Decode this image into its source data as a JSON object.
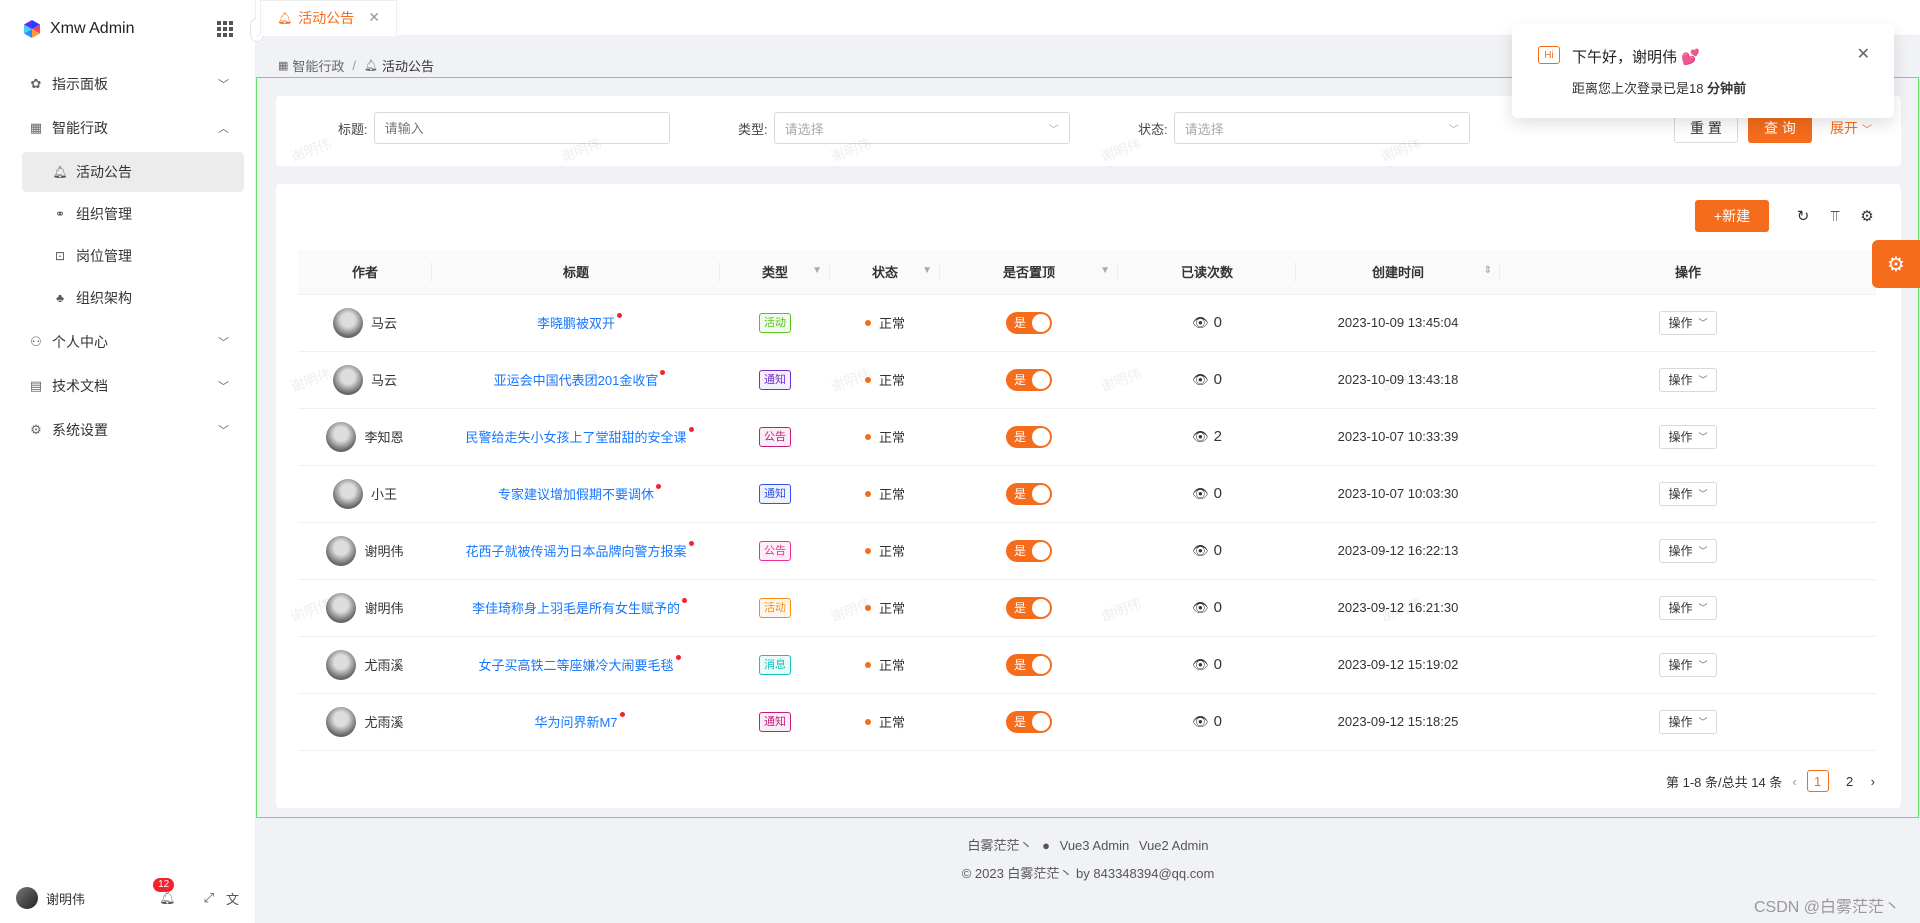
{
  "app": {
    "title": "Xmw Admin"
  },
  "sidebar": {
    "items": [
      {
        "label": "指示面板",
        "icon": "dashboard-icon",
        "expanded": false
      },
      {
        "label": "智能行政",
        "icon": "building-icon",
        "expanded": true,
        "children": [
          {
            "label": "活动公告",
            "icon": "bell-icon",
            "active": true
          },
          {
            "label": "组织管理",
            "icon": "org-icon"
          },
          {
            "label": "岗位管理",
            "icon": "position-icon"
          },
          {
            "label": "组织架构",
            "icon": "sitemap-icon"
          }
        ]
      },
      {
        "label": "个人中心",
        "icon": "user-icon",
        "expanded": false
      },
      {
        "label": "技术文档",
        "icon": "doc-icon",
        "expanded": false
      },
      {
        "label": "系统设置",
        "icon": "gear-icon",
        "expanded": false
      }
    ],
    "user": {
      "name": "谢明伟",
      "notifications": "12"
    }
  },
  "tabs": [
    {
      "label": "活动公告",
      "active": true
    }
  ],
  "breadcrumb": [
    "智能行政",
    "活动公告"
  ],
  "search": {
    "title_label": "标题:",
    "title_placeholder": "请输入",
    "type_label": "类型:",
    "type_placeholder": "请选择",
    "status_label": "状态:",
    "status_placeholder": "请选择",
    "reset": "重 置",
    "query": "查 询",
    "expand": "展开"
  },
  "toolbar": {
    "new_label": "+新建"
  },
  "table": {
    "columns": [
      "作者",
      "标题",
      "类型",
      "状态",
      "是否置顶",
      "已读次数",
      "创建时间",
      "操作"
    ],
    "rows": [
      {
        "author": "马云",
        "title": "李晓鹏被双开",
        "type": "活动",
        "type_color": "#52c41a",
        "status": "正常",
        "pinned": "是",
        "reads": "0",
        "created": "2023-10-09 13:45:04",
        "op": "操作"
      },
      {
        "author": "马云",
        "title": "亚运会中国代表团201金收官",
        "type": "通知",
        "type_color": "#722ed1",
        "status": "正常",
        "pinned": "是",
        "reads": "0",
        "created": "2023-10-09 13:43:18",
        "op": "操作"
      },
      {
        "author": "李知恩",
        "title": "民警给走失小女孩上了堂甜甜的安全课",
        "type": "公告",
        "type_color": "#c41d7f",
        "status": "正常",
        "pinned": "是",
        "reads": "2",
        "created": "2023-10-07 10:33:39",
        "op": "操作"
      },
      {
        "author": "小王",
        "title": "专家建议增加假期不要调休",
        "type": "通知",
        "type_color": "#2f54eb",
        "status": "正常",
        "pinned": "是",
        "reads": "0",
        "created": "2023-10-07 10:03:30",
        "op": "操作"
      },
      {
        "author": "谢明伟",
        "title": "花西子就被传谣为日本品牌向警方报案",
        "type": "公告",
        "type_color": "#eb2f96",
        "status": "正常",
        "pinned": "是",
        "reads": "0",
        "created": "2023-09-12 16:22:13",
        "op": "操作"
      },
      {
        "author": "谢明伟",
        "title": "李佳琦称身上羽毛是所有女生赋予的",
        "type": "活动",
        "type_color": "#fa8c16",
        "status": "正常",
        "pinned": "是",
        "reads": "0",
        "created": "2023-09-12 16:21:30",
        "op": "操作"
      },
      {
        "author": "尤雨溪",
        "title": "女子买高铁二等座嫌冷大闹要毛毯",
        "type": "消息",
        "type_color": "#13c2c2",
        "status": "正常",
        "pinned": "是",
        "reads": "0",
        "created": "2023-09-12 15:19:02",
        "op": "操作"
      },
      {
        "author": "尤雨溪",
        "title": "华为问界新M7",
        "type": "通知",
        "type_color": "#c41d7f",
        "status": "正常",
        "pinned": "是",
        "reads": "0",
        "created": "2023-09-12 15:18:25",
        "op": "操作"
      }
    ]
  },
  "pagination": {
    "summary": "第 1-8 条/总共 14 条",
    "pages": [
      "1",
      "2"
    ],
    "current": "1"
  },
  "footer": {
    "line1_a": "白雾茫茫丶",
    "line1_b": "Vue3 Admin",
    "line1_c": "Vue2 Admin",
    "line2": "© 2023 白雾茫茫丶  by 843348394@qq.com"
  },
  "notification": {
    "hi": "Hi",
    "title": "下午好，谢明伟 💕",
    "body_prefix": "距离您上次登录已是18 ",
    "body_bold": "分钟前"
  },
  "watermark": {
    "text": "谢明伟",
    "corner": "CSDN @白雾茫茫丶"
  },
  "colors": {
    "accent": "#f56c1c",
    "link": "#1677ff"
  }
}
